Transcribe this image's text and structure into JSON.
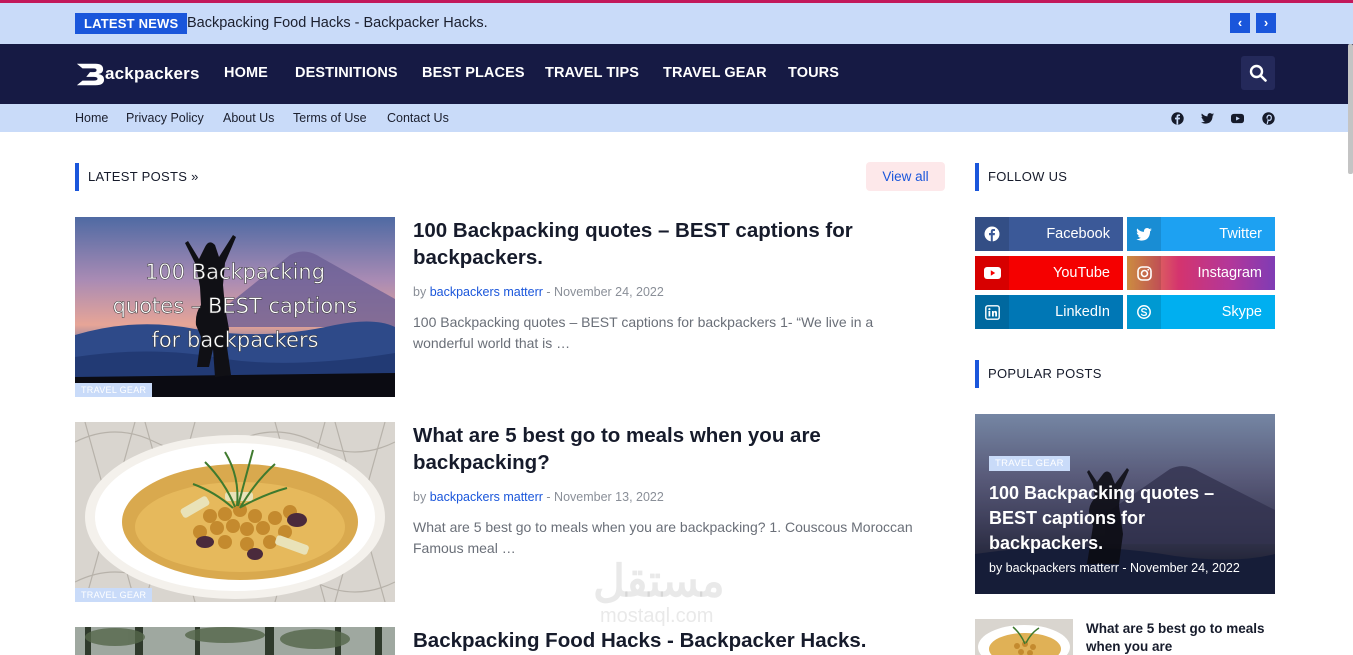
{
  "topbar": {
    "label": "LATEST NEWS",
    "headline": "Backpacking Food Hacks - Backpacker Hacks.",
    "prev_icon": "chevron-left-icon",
    "next_icon": "chevron-right-icon"
  },
  "logo": {
    "text": "ackpackers"
  },
  "nav": {
    "items": [
      "HOME",
      "DESTINITIONS",
      "BEST PLACES",
      "TRAVEL TIPS",
      "TRAVEL GEAR",
      "TOURS"
    ],
    "search_icon": "search-icon"
  },
  "subnav": {
    "items": [
      "Home",
      "Privacy Policy",
      "About Us",
      "Terms of Use",
      "Contact Us"
    ],
    "social_icons": [
      "facebook-icon",
      "twitter-icon",
      "youtube-icon",
      "pinterest-icon"
    ]
  },
  "latest": {
    "heading": "LATEST POSTS »",
    "view_all": "View all",
    "posts": [
      {
        "tag": "TRAVEL GEAR",
        "image_caption": [
          "100 Backpacking",
          "quotes – BEST captions",
          "for backpackers"
        ],
        "title": "100 Backpacking quotes – BEST captions for backpackers.",
        "by": "by",
        "author": "backpackers matterr",
        "date": "- November 24, 2022",
        "excerpt": "100 Backpacking quotes – BEST captions for backpackers 1- “We live in a wonderful world that is …"
      },
      {
        "tag": "TRAVEL GEAR",
        "title": "What are 5 best go to meals when you are backpacking?",
        "by": "by",
        "author": "backpackers matterr",
        "date": "- November 13, 2022",
        "excerpt": "What are 5 best go to meals   when you are backpacking?     1. Couscous Moroccan Famous meal …"
      },
      {
        "title": "Backpacking Food Hacks - Backpacker Hacks."
      }
    ]
  },
  "follow": {
    "heading": "FOLLOW US",
    "buttons": [
      {
        "label": "Facebook",
        "icon": "facebook-icon",
        "color": "#3b5998"
      },
      {
        "label": "Twitter",
        "icon": "twitter-icon",
        "color": "#1da1f2"
      },
      {
        "label": "YouTube",
        "icon": "youtube-icon",
        "color": "#f50000"
      },
      {
        "label": "Instagram",
        "icon": "instagram-icon",
        "color": "#c13584"
      },
      {
        "label": "LinkedIn",
        "icon": "linkedin-icon",
        "color": "#0077b5"
      },
      {
        "label": "Skype",
        "icon": "skype-icon",
        "color": "#00aff0"
      }
    ]
  },
  "popular": {
    "heading": "POPULAR POSTS",
    "featured": {
      "tag": "TRAVEL GEAR",
      "title": "100 Backpacking quotes – BEST captions for backpackers.",
      "meta": "by backpackers matterr - November 24, 2022"
    },
    "second": {
      "title": "What are 5 best go to meals when you are"
    }
  },
  "watermark": {
    "text": "مستقل",
    "sub": "mostaql.com"
  },
  "colors": {
    "accent": "#1a56db",
    "nav_bg": "#161a44",
    "light_bar": "#c9dbf9"
  }
}
